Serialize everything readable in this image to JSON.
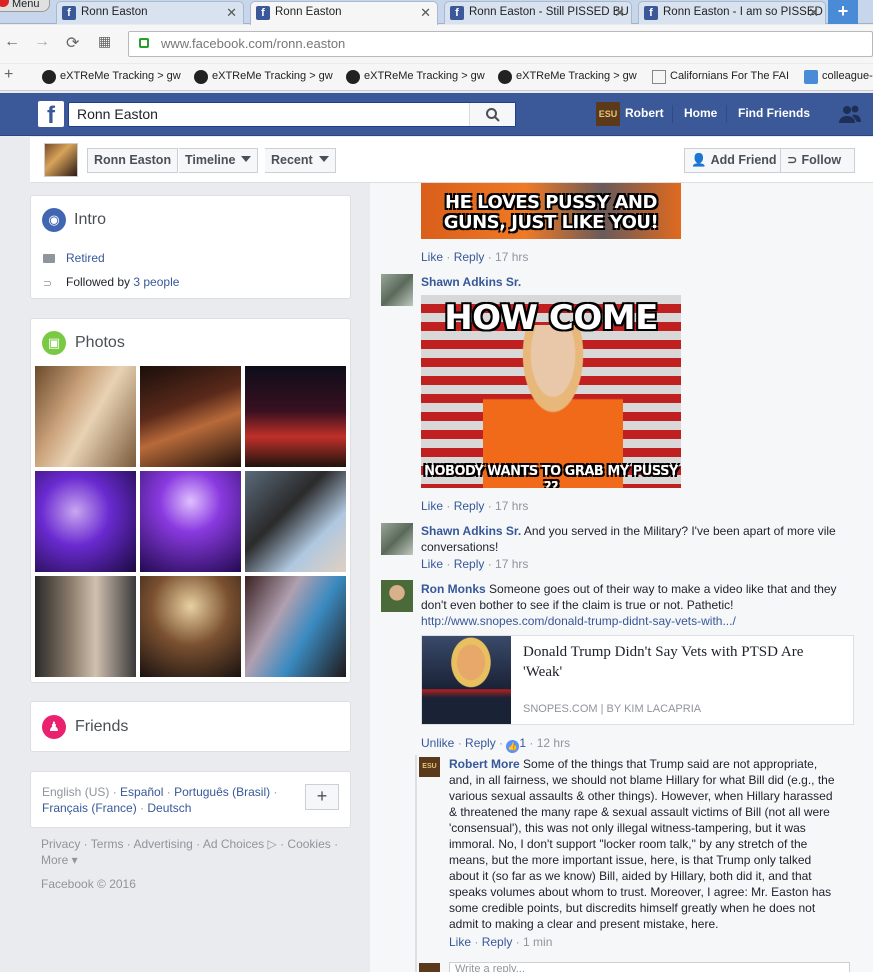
{
  "browser": {
    "menu_label": "Menu",
    "tabs": [
      {
        "title": "Ronn Easton"
      },
      {
        "title": "Ronn Easton"
      },
      {
        "title": "Ronn Easton - Still PISSED BU"
      },
      {
        "title": "Ronn Easton - I am so PISSED"
      }
    ],
    "newtab_label": "+",
    "url_host": "www.facebook.com",
    "url_path": "/ronn.easton",
    "bookmarks": [
      {
        "label": "eXTReMe Tracking > gw"
      },
      {
        "label": "eXTReMe Tracking > gw"
      },
      {
        "label": "eXTReMe Tracking > gw"
      },
      {
        "label": "eXTReMe Tracking > gw"
      },
      {
        "label": "Californians For The FAI"
      },
      {
        "label": "colleague-"
      }
    ]
  },
  "fb": {
    "search_value": "Ronn Easton",
    "user_name": "Robert",
    "user_avatar_text": "ESU",
    "nav_home": "Home",
    "nav_find_friends": "Find Friends"
  },
  "profile_bar": {
    "name_button": "Ronn Easton",
    "timeline_button": "Timeline",
    "recent_button": "Recent",
    "add_friend": "Add Friend",
    "follow": "Follow"
  },
  "intro": {
    "title": "Intro",
    "work": "Retired",
    "followed_prefix": "Followed by ",
    "followed_link": "3 people"
  },
  "photos": {
    "title": "Photos"
  },
  "friends": {
    "title": "Friends"
  },
  "languages": {
    "current": "English (US) · ",
    "items": [
      "Español",
      "Português (Brasil)",
      "Français (France)",
      "Deutsch"
    ],
    "add_label": "+"
  },
  "footer": {
    "links": "Privacy · Terms · Advertising · Ad Choices ▷ · Cookies · More ▾",
    "copyright": "Facebook © 2016"
  },
  "comments": {
    "meme1": {
      "text": "HE LOVES PUSSY AND GUNS, JUST LIKE YOU!",
      "like": "Like",
      "reply": "Reply",
      "time": "17 hrs"
    },
    "c2": {
      "name": "Shawn Adkins Sr.",
      "meme_top": "HOW COME",
      "meme_bottom": "NOBODY WANTS TO GRAB MY PUSSY ??",
      "like": "Like",
      "reply": "Reply",
      "time": "17 hrs"
    },
    "c3": {
      "name": "Shawn Adkins Sr.",
      "text": "And you served in the Military? I've been apart of more vile conversations!",
      "like": "Like",
      "reply": "Reply",
      "time": "17 hrs"
    },
    "c4": {
      "name": "Ron Monks",
      "text": "Someone goes out of their way to make a video like that and they don't even bother to see if the claim is true or not. Pathetic!",
      "url": "http://www.snopes.com/donald-trump-didnt-say-vets-with.../",
      "link_title": "Donald Trump Didn't Say Vets with PTSD Are 'Weak'",
      "link_source": "SNOPES.COM | BY KIM LACAPRIA",
      "unlike": "Unlike",
      "reply": "Reply",
      "like_count": "1",
      "time": "12 hrs"
    },
    "c5": {
      "name": "Robert More",
      "avatar_text": "ESU",
      "text": "Some of the things that Trump said are not appropriate, and, in all fairness, we should not blame Hillary for what Bill did (e.g., the various sexual assaults & other things). However, when Hillary harassed & threatened the many rape & sexual assault victims of Bill (not all were 'consensual'), this was not only illegal witness-tampering, but it was immoral. No, I don't support \"locker room talk,\" by any stretch of the means, but the more important issue, here, is that Trump only talked about it (so far as we know) Bill, aided by Hillary, both did it, and that speaks volumes about whom to trust. Moreover, I agree: Mr. Easton has some credible points, but discredits himself greatly when he does not admit to making a clear and present mistake, here.",
      "like": "Like",
      "reply": "Reply",
      "time": "1 min"
    },
    "reply_placeholder": "Write a reply..."
  },
  "colors": {
    "fb_blue": "#3b5998",
    "link": "#365899",
    "bg": "#e9ebee"
  }
}
